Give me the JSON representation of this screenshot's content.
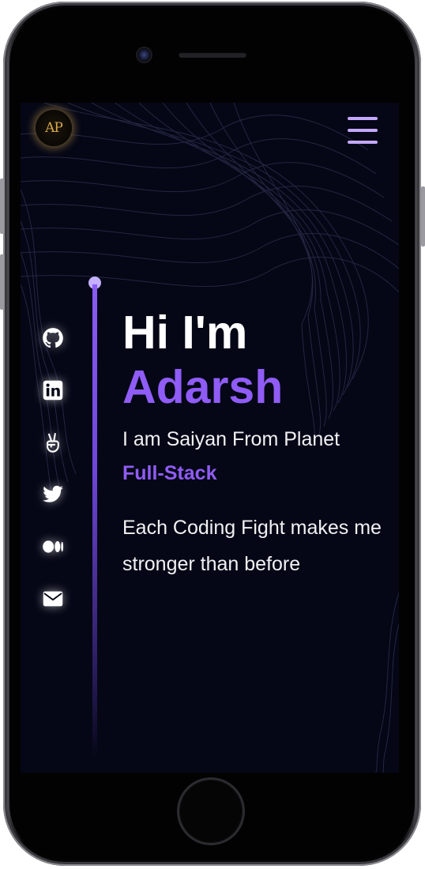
{
  "header": {
    "logo_text": "AP",
    "menu_icon": "hamburger-menu-icon"
  },
  "social": [
    {
      "name": "github",
      "icon": "github-icon"
    },
    {
      "name": "linkedin",
      "icon": "linkedin-icon"
    },
    {
      "name": "peace",
      "icon": "peace-hand-icon"
    },
    {
      "name": "twitter",
      "icon": "twitter-icon"
    },
    {
      "name": "medium",
      "icon": "medium-icon"
    },
    {
      "name": "email",
      "icon": "mail-icon"
    }
  ],
  "hero": {
    "greeting": "Hi I'm",
    "name": "Adarsh",
    "subtitle": "I am Saiyan From Planet",
    "role": "Full-Stack",
    "quote": "Each Coding Fight makes me stronger than before"
  },
  "colors": {
    "background": "#050716",
    "accent": "#8f5cf7",
    "menu": "#c4a8ff",
    "text": "#f1f1f4"
  }
}
